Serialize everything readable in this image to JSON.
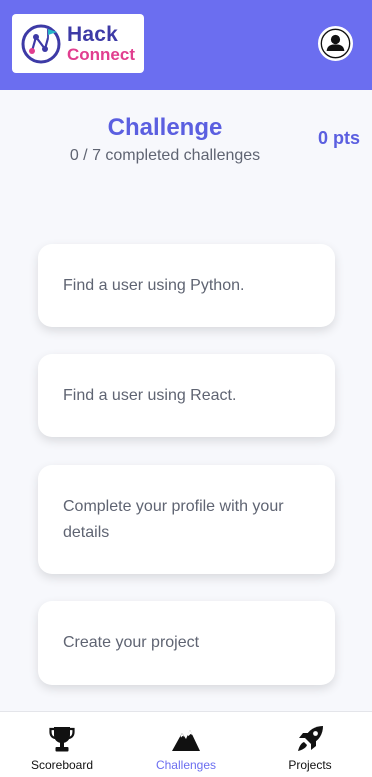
{
  "app": {
    "logo_line1": "Hack",
    "logo_line2": "Connect"
  },
  "colors": {
    "accent": "#6b6ef0",
    "brand_dark": "#3d3aa6",
    "brand_pink": "#e13e8f",
    "text": "#5f6472"
  },
  "header": {
    "title": "Challenge",
    "subtitle": "0 / 7 completed challenges",
    "points": "0 pts"
  },
  "challenges": [
    {
      "label": "Find a user using Python."
    },
    {
      "label": "Find a user using React."
    },
    {
      "label": "Complete your profile with your details"
    },
    {
      "label": "Create your project"
    }
  ],
  "nav": {
    "items": [
      {
        "label": "Scoreboard",
        "icon": "trophy-icon"
      },
      {
        "label": "Challenges",
        "icon": "mountain-icon",
        "active": true
      },
      {
        "label": "Projects",
        "icon": "rocket-icon"
      }
    ]
  }
}
